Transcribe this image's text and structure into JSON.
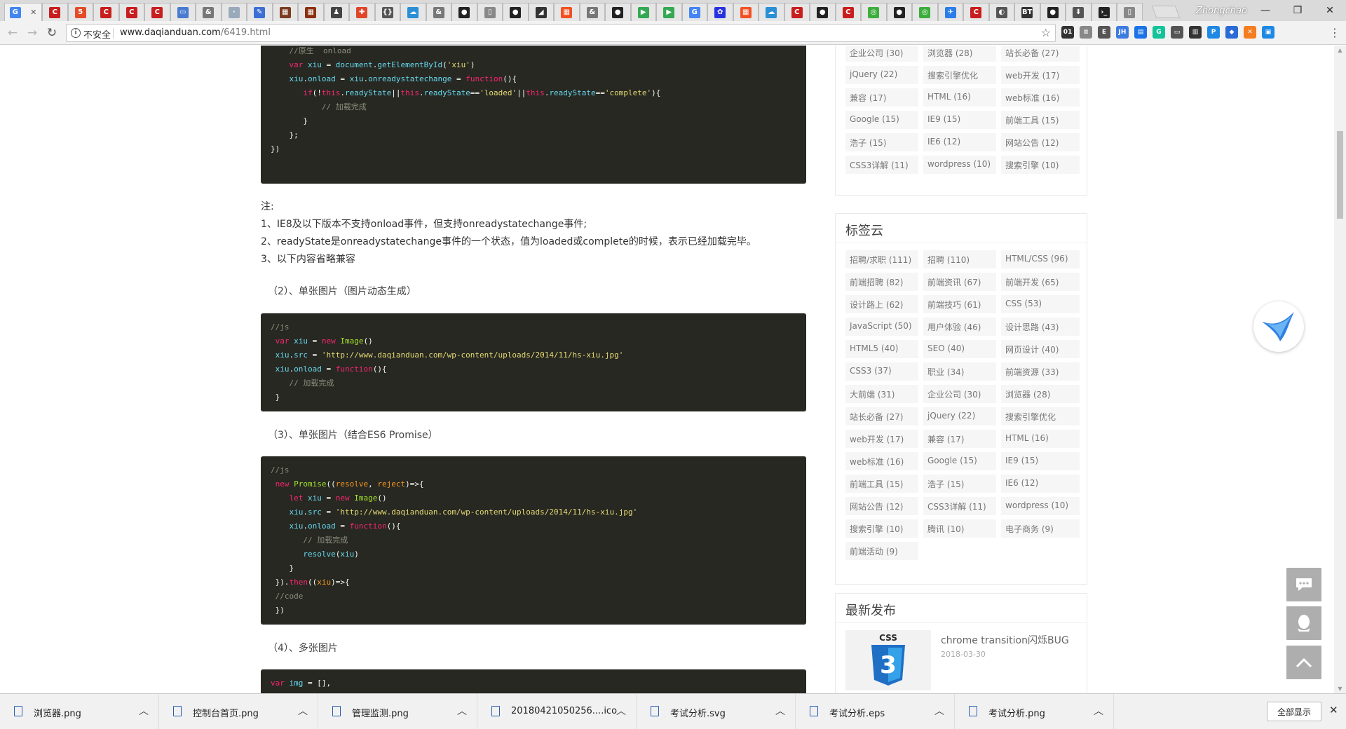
{
  "browser": {
    "tabs": [
      {
        "icon": "google-icon",
        "glyph": "G",
        "color": "#4285f4",
        "active": true
      },
      {
        "icon": "csdn-icon",
        "glyph": "C",
        "color": "#c81e1e"
      },
      {
        "icon": "h5-icon",
        "glyph": "5",
        "color": "#e34c26"
      },
      {
        "icon": "csdn-icon",
        "glyph": "C",
        "color": "#c81e1e"
      },
      {
        "icon": "csdn-icon",
        "glyph": "C",
        "color": "#c81e1e"
      },
      {
        "icon": "csdn-icon",
        "glyph": "C",
        "color": "#c81e1e"
      },
      {
        "icon": "site-icon",
        "glyph": "▭",
        "color": "#4a7bd0"
      },
      {
        "icon": "ampersand-icon",
        "glyph": "&",
        "color": "#777"
      },
      {
        "icon": "blank-icon",
        "glyph": "·",
        "color": "#9ab"
      },
      {
        "icon": "pen-icon",
        "glyph": "✎",
        "color": "#3b6fd6"
      },
      {
        "icon": "photo-icon",
        "glyph": "▦",
        "color": "#7a3b20"
      },
      {
        "icon": "photo-icon",
        "glyph": "▦",
        "color": "#8a3010"
      },
      {
        "icon": "person-icon",
        "glyph": "♟",
        "color": "#444"
      },
      {
        "icon": "puzzle-icon",
        "glyph": "✚",
        "color": "#e0452a"
      },
      {
        "icon": "brackets-icon",
        "glyph": "{}",
        "color": "#555"
      },
      {
        "icon": "cloud-icon",
        "glyph": "☁",
        "color": "#2b8fd6"
      },
      {
        "icon": "ampersand-icon",
        "glyph": "&",
        "color": "#777"
      },
      {
        "icon": "github-icon",
        "glyph": "●",
        "color": "#222"
      },
      {
        "icon": "doc-icon",
        "glyph": "▯",
        "color": "#888"
      },
      {
        "icon": "github-icon",
        "glyph": "●",
        "color": "#222"
      },
      {
        "icon": "slash-icon",
        "glyph": "◢",
        "color": "#333"
      },
      {
        "icon": "windows-icon",
        "glyph": "▦",
        "color": "#f25022"
      },
      {
        "icon": "ampersand-icon",
        "glyph": "&",
        "color": "#777"
      },
      {
        "icon": "github-icon",
        "glyph": "●",
        "color": "#222"
      },
      {
        "icon": "play-icon",
        "glyph": "▶",
        "color": "#34a853"
      },
      {
        "icon": "play-icon",
        "glyph": "▶",
        "color": "#34a853"
      },
      {
        "icon": "google-icon",
        "glyph": "G",
        "color": "#4285f4"
      },
      {
        "icon": "baidu-icon",
        "glyph": "✿",
        "color": "#2932e1"
      },
      {
        "icon": "windows-icon",
        "glyph": "▦",
        "color": "#f25022"
      },
      {
        "icon": "cloud-icon",
        "glyph": "☁",
        "color": "#2b8fd6"
      },
      {
        "icon": "csdn-icon",
        "glyph": "C",
        "color": "#c81e1e"
      },
      {
        "icon": "github-icon",
        "glyph": "●",
        "color": "#222"
      },
      {
        "icon": "csdn-icon",
        "glyph": "C",
        "color": "#c81e1e"
      },
      {
        "icon": "wechat-icon",
        "glyph": "◎",
        "color": "#3dae3d"
      },
      {
        "icon": "github-icon",
        "glyph": "●",
        "color": "#222"
      },
      {
        "icon": "wechat-icon",
        "glyph": "◎",
        "color": "#3dae3d"
      },
      {
        "icon": "bird-icon",
        "glyph": "✈",
        "color": "#2b7de9"
      },
      {
        "icon": "csdn-icon",
        "glyph": "C",
        "color": "#c81e1e"
      },
      {
        "icon": "site-icon",
        "glyph": "◐",
        "color": "#555"
      },
      {
        "icon": "bt-icon",
        "glyph": "BT",
        "color": "#333"
      },
      {
        "icon": "github-icon",
        "glyph": "●",
        "color": "#222"
      },
      {
        "icon": "download-icon",
        "glyph": "⬇",
        "color": "#555"
      },
      {
        "icon": "terminal-icon",
        "glyph": "›_",
        "color": "#222"
      },
      {
        "icon": "doc-icon",
        "glyph": "▯",
        "color": "#888"
      }
    ],
    "profile_name": "Zhongchao",
    "security_label": "不安全",
    "url_host": "www.daqianduan.com",
    "url_path": "/6419.html",
    "extensions": [
      {
        "icon": "o1-icon",
        "glyph": "01",
        "color": "#333"
      },
      {
        "icon": "list-icon",
        "glyph": "≡",
        "color": "#888"
      },
      {
        "icon": "evernote-icon",
        "glyph": "E",
        "color": "#555"
      },
      {
        "icon": "jh-icon",
        "glyph": "JH",
        "color": "#3d7be0"
      },
      {
        "icon": "note-icon",
        "glyph": "▤",
        "color": "#1a73e8"
      },
      {
        "icon": "grammarly-icon",
        "glyph": "G",
        "color": "#15c39a"
      },
      {
        "icon": "form-icon",
        "glyph": "▭",
        "color": "#555"
      },
      {
        "icon": "film-icon",
        "glyph": "▥",
        "color": "#333"
      },
      {
        "icon": "proxy-icon",
        "glyph": "P",
        "color": "#1e88e5"
      },
      {
        "icon": "gem-icon",
        "glyph": "◆",
        "color": "#2b6bd6"
      },
      {
        "icon": "x-ext-icon",
        "glyph": "✕",
        "color": "#f47d20"
      },
      {
        "icon": "screen-icon",
        "glyph": "▣",
        "color": "#1e88e5"
      }
    ]
  },
  "code_blocks": {
    "block1": [
      [
        [
          "    ",
          ""
        ],
        [
          "//原生  onload",
          "c"
        ]
      ],
      [
        [
          "    ",
          ""
        ],
        [
          "var",
          "k"
        ],
        [
          " xiu ",
          "v"
        ],
        [
          "= ",
          ""
        ],
        [
          "document",
          "v"
        ],
        [
          ".",
          ""
        ],
        [
          "getElementById",
          "v"
        ],
        [
          "(",
          ""
        ],
        [
          "'xiu'",
          "s"
        ],
        [
          ")",
          ""
        ]
      ],
      [
        [
          "    ",
          ""
        ],
        [
          "xiu",
          "v"
        ],
        [
          ".",
          ""
        ],
        [
          "onload",
          "v"
        ],
        [
          " = ",
          ""
        ],
        [
          "xiu",
          "v"
        ],
        [
          ".",
          ""
        ],
        [
          "onreadystatechange",
          "v"
        ],
        [
          " = ",
          ""
        ],
        [
          "function",
          "k"
        ],
        [
          "(){",
          ""
        ]
      ],
      [
        [
          "       ",
          ""
        ],
        [
          "if",
          "k"
        ],
        [
          "(!",
          ""
        ],
        [
          "this",
          "k"
        ],
        [
          ".",
          ""
        ],
        [
          "readyState",
          "v"
        ],
        [
          "||",
          ""
        ],
        [
          "this",
          "k"
        ],
        [
          ".",
          ""
        ],
        [
          "readyState",
          "v"
        ],
        [
          "==",
          ""
        ],
        [
          "'loaded'",
          "s"
        ],
        [
          "||",
          ""
        ],
        [
          "this",
          "k"
        ],
        [
          ".",
          ""
        ],
        [
          "readyState",
          "v"
        ],
        [
          "==",
          ""
        ],
        [
          "'complete'",
          "s"
        ],
        [
          "){",
          ""
        ]
      ],
      [
        [
          "           ",
          ""
        ],
        [
          "// 加载完成",
          "c"
        ]
      ],
      [
        [
          "       }",
          ""
        ]
      ],
      [
        [
          "    };",
          ""
        ]
      ],
      [
        [
          "",
          ""
        ]
      ],
      [
        [
          "})",
          ""
        ]
      ]
    ],
    "block2": [
      [
        [
          "//js",
          "c"
        ]
      ],
      [
        [
          " ",
          ""
        ],
        [
          "var",
          "k"
        ],
        [
          " xiu ",
          "v"
        ],
        [
          "= ",
          ""
        ],
        [
          "new",
          "k"
        ],
        [
          " ",
          ""
        ],
        [
          "Image",
          "f"
        ],
        [
          "()",
          ""
        ]
      ],
      [
        [
          " ",
          ""
        ],
        [
          "xiu",
          "v"
        ],
        [
          ".",
          ""
        ],
        [
          "src",
          "v"
        ],
        [
          " = ",
          ""
        ],
        [
          "'http://www.daqianduan.com/wp-content/uploads/2014/11/hs-xiu.jpg'",
          "s"
        ]
      ],
      [
        [
          " ",
          ""
        ],
        [
          "xiu",
          "v"
        ],
        [
          ".",
          ""
        ],
        [
          "onload",
          "v"
        ],
        [
          " = ",
          ""
        ],
        [
          "function",
          "k"
        ],
        [
          "(){",
          ""
        ]
      ],
      [
        [
          "    ",
          ""
        ],
        [
          "// 加载完成",
          "c"
        ]
      ],
      [
        [
          " }",
          ""
        ]
      ]
    ],
    "block3": [
      [
        [
          "//js",
          "c"
        ]
      ],
      [
        [
          " ",
          ""
        ],
        [
          "new",
          "k"
        ],
        [
          " ",
          ""
        ],
        [
          "Promise",
          "f"
        ],
        [
          "((",
          ""
        ],
        [
          "resolve",
          "p"
        ],
        [
          ", ",
          ""
        ],
        [
          "reject",
          "p"
        ],
        [
          ")=>{",
          ""
        ]
      ],
      [
        [
          "    ",
          ""
        ],
        [
          "let",
          "k"
        ],
        [
          " xiu ",
          "v"
        ],
        [
          "= ",
          ""
        ],
        [
          "new",
          "k"
        ],
        [
          " ",
          ""
        ],
        [
          "Image",
          "f"
        ],
        [
          "()",
          ""
        ]
      ],
      [
        [
          "    ",
          ""
        ],
        [
          "xiu",
          "v"
        ],
        [
          ".",
          ""
        ],
        [
          "src",
          "v"
        ],
        [
          " = ",
          ""
        ],
        [
          "'http://www.daqianduan.com/wp-content/uploads/2014/11/hs-xiu.jpg'",
          "s"
        ]
      ],
      [
        [
          "    ",
          ""
        ],
        [
          "xiu",
          "v"
        ],
        [
          ".",
          ""
        ],
        [
          "onload",
          "v"
        ],
        [
          " = ",
          ""
        ],
        [
          "function",
          "k"
        ],
        [
          "(){",
          ""
        ]
      ],
      [
        [
          "       ",
          ""
        ],
        [
          "// 加载完成",
          "c"
        ]
      ],
      [
        [
          "       ",
          ""
        ],
        [
          "resolve",
          "v"
        ],
        [
          "(",
          ""
        ],
        [
          "xiu",
          "v"
        ],
        [
          ")",
          ""
        ]
      ],
      [
        [
          "    }",
          ""
        ]
      ],
      [
        [
          " }).",
          ""
        ],
        [
          "then",
          "k"
        ],
        [
          "((",
          ""
        ],
        [
          "xiu",
          "p"
        ],
        [
          ")=>{",
          ""
        ]
      ],
      [
        [
          " ",
          ""
        ],
        [
          "//code",
          "c"
        ]
      ],
      [
        [
          " })",
          ""
        ]
      ]
    ],
    "block4": [
      [
        [
          "var",
          "k"
        ],
        [
          " img ",
          "v"
        ],
        [
          "= [],",
          ""
        ]
      ]
    ]
  },
  "notes": {
    "label": "注:",
    "line1": "1、IE8及以下版本不支持onload事件，但支持onreadystatechange事件;",
    "line2": "2、readyState是onreadystatechange事件的一个状态，值为loaded或complete的时候，表示已经加载完毕。",
    "line3": "3、以下内容省略兼容"
  },
  "subheads": {
    "s2": "（2）、单张图片（图片动态生成）",
    "s3": "（3）、单张图片（结合ES6 Promise）",
    "s4": "（4）、多张图片"
  },
  "sidebar": {
    "hot_tags": [
      "企业公司 (30)",
      "浏览器 (28)",
      "站长必备 (27)",
      "jQuery (22)",
      "搜索引擎优化",
      "web开发 (17)",
      "兼容 (17)",
      "HTML (16)",
      "web标准 (16)",
      "Google (15)",
      "IE9 (15)",
      "前端工具 (15)",
      "浩子 (15)",
      "IE6 (12)",
      "网站公告 (12)",
      "CSS3详解 (11)",
      "wordpress (10)",
      "搜索引擎 (10)"
    ],
    "tag_cloud_title": "标签云",
    "tag_cloud": [
      "招聘/求职 (111)",
      "招聘 (110)",
      "HTML/CSS (96)",
      "前端招聘 (82)",
      "前端资讯 (67)",
      "前端开发 (65)",
      "设计路上 (62)",
      "前端技巧 (61)",
      "CSS (53)",
      "JavaScript (50)",
      "用户体验 (46)",
      "设计思路 (43)",
      "HTML5 (40)",
      "SEO (40)",
      "网页设计 (40)",
      "CSS3 (37)",
      "职业 (34)",
      "前端资源 (33)",
      "大前端 (31)",
      "企业公司 (30)",
      "浏览器 (28)",
      "站长必备 (27)",
      "jQuery (22)",
      "搜索引擎优化",
      "web开发 (17)",
      "兼容 (17)",
      "HTML (16)",
      "web标准 (16)",
      "Google (15)",
      "IE9 (15)",
      "前端工具 (15)",
      "浩子 (15)",
      "IE6 (12)",
      "网站公告 (12)",
      "CSS3详解 (11)",
      "wordpress (10)",
      "搜索引擎 (10)",
      "腾讯 (10)",
      "电子商务 (9)",
      "前端活动 (9)"
    ],
    "recent_title": "最新发布",
    "recent_items": [
      {
        "title": "chrome transition闪烁BUG",
        "date": "2018-03-30",
        "thumb_label": "CSS",
        "thumb_number": "3"
      }
    ]
  },
  "downloads": {
    "items": [
      {
        "name": "浏览器.png",
        "icon": "image-file-icon"
      },
      {
        "name": "控制台首页.png",
        "icon": "image-file-icon"
      },
      {
        "name": "管理监测.png",
        "icon": "image-file-icon"
      },
      {
        "name": "20180421050256....ico",
        "icon": "ico-file-icon"
      },
      {
        "name": "考试分析.svg",
        "icon": "svg-file-icon"
      },
      {
        "name": "考试分析.eps",
        "icon": "eps-file-icon"
      },
      {
        "name": "考试分析.png",
        "icon": "image-file-icon"
      }
    ],
    "show_all_label": "全部显示"
  }
}
